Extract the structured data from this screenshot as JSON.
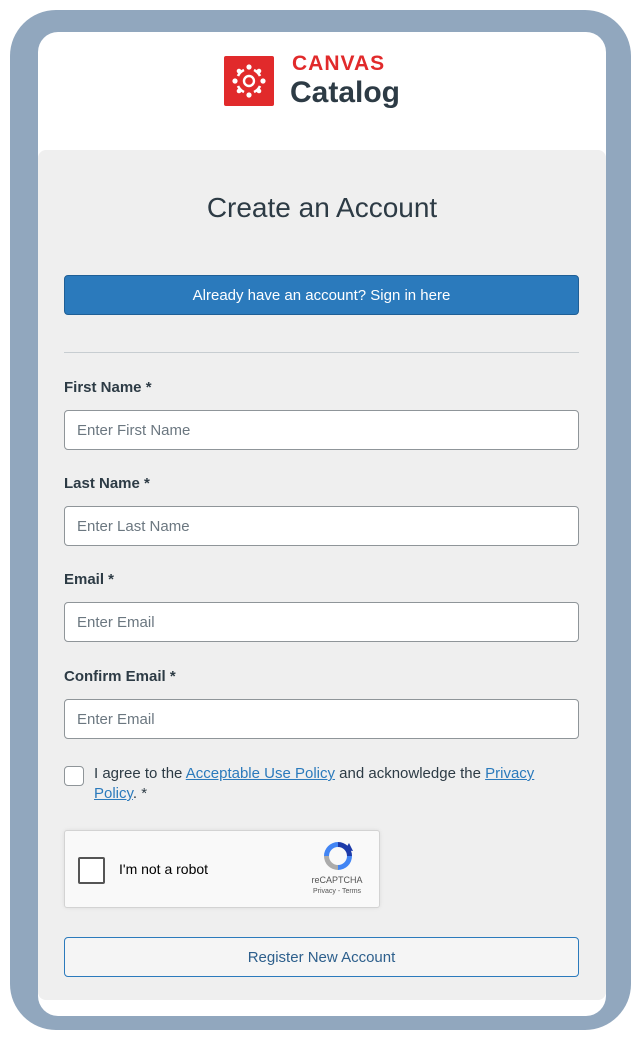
{
  "brand": {
    "top": "CANVAS",
    "bottom": "Catalog",
    "badge_color": "#e12a2b"
  },
  "form": {
    "title": "Create an Account",
    "signin_label": "Already have an account? Sign in here",
    "fields": [
      {
        "label": "First Name *",
        "placeholder": "Enter First Name",
        "value": ""
      },
      {
        "label": "Last Name *",
        "placeholder": "Enter Last Name",
        "value": ""
      },
      {
        "label": "Email *",
        "placeholder": "Enter Email",
        "value": ""
      },
      {
        "label": "Confirm Email *",
        "placeholder": "Enter Email",
        "value": ""
      }
    ],
    "agreement": {
      "prefix": "I agree to the ",
      "link1": "Acceptable Use Policy",
      "middle": " and acknowledge the ",
      "link2": "Privacy Policy",
      "suffix": ". *",
      "checked": false
    },
    "recaptcha": {
      "label": "I'm not a robot",
      "brand": "reCAPTCHA",
      "links": "Privacy - Terms",
      "checked": false
    },
    "register_label": "Register New Account"
  },
  "colors": {
    "accent": "#2b7abc",
    "frame": "#91a7be",
    "panel": "#efefef"
  }
}
